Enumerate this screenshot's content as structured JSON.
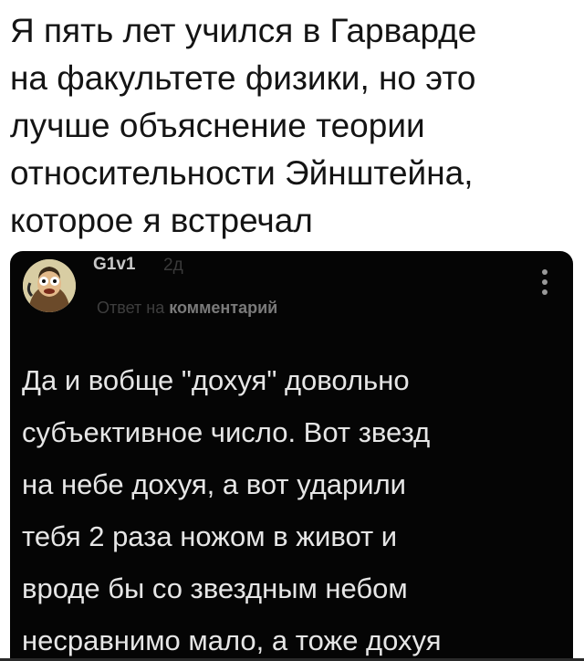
{
  "caption": {
    "lines": [
      "Я пять лет учился в Гарварде",
      "на факультете физики, но это",
      "лучше объяснение теории",
      "относительности Эйнштейна,",
      "которое я встречал"
    ]
  },
  "comment": {
    "author": "G1v1",
    "time": "2д",
    "reply_prefix": "Ответ на",
    "reply_target": "комментарий",
    "avatar_icon": "cartoon-character-avatar-icon",
    "menu_icon": "vertical-dots-menu-icon",
    "lines": [
      "Да и вобще \"дохуя\" довольно",
      "субъективное число. Вот звезд",
      "на небе дохуя, а вот ударили",
      "тебя 2 раза ножом в живот и",
      "вроде бы со звездным небом",
      "несравнимо мало, а тоже дохуя"
    ]
  },
  "colors": {
    "page_background": "#ffffff",
    "caption_text": "#141414",
    "card_background": "#050505",
    "comment_text": "#e6e6e6"
  }
}
